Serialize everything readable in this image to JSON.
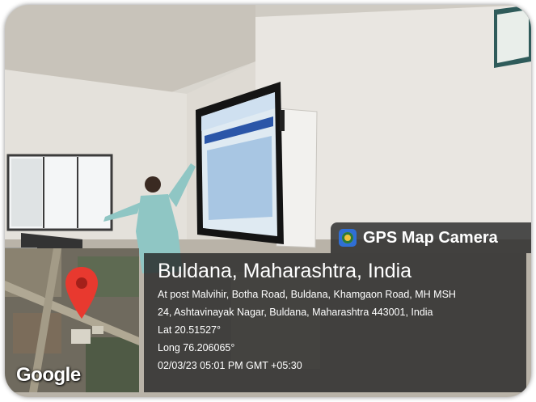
{
  "overlay": {
    "app_name": "GPS Map Camera",
    "location_title": "Buldana, Maharashtra, India",
    "address_line1": "At post Malvihir, Botha Road, Buldana, Khamgaon Road, MH MSH",
    "address_line2": "24, Ashtavinayak Nagar, Buldana, Maharashtra 443001, India",
    "lat": "Lat 20.51527°",
    "long": "Long 76.206065°",
    "datetime": "02/03/23 05:01 PM GMT +05:30",
    "map_brand": "Google"
  },
  "icons": [
    "gps-map-camera-app-icon",
    "map-pin-icon"
  ],
  "colors": {
    "pin": "#e8392f",
    "panel": "#232323",
    "app_icon": "#2f6fd6"
  }
}
